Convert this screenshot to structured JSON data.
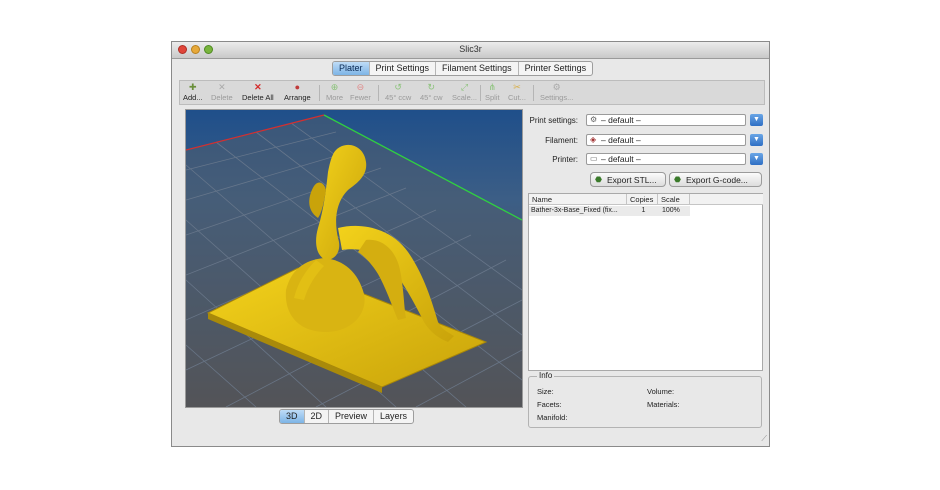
{
  "window": {
    "title": "Slic3r"
  },
  "tabs": [
    {
      "label": "Plater"
    },
    {
      "label": "Print Settings"
    },
    {
      "label": "Filament Settings"
    },
    {
      "label": "Printer Settings"
    }
  ],
  "toolbar": {
    "add": "Add...",
    "delete": "Delete",
    "delete_all": "Delete All",
    "arrange": "Arrange",
    "more": "More",
    "fewer": "Fewer",
    "rotate_ccw": "45° ccw",
    "rotate_cw": "45° cw",
    "scale": "Scale...",
    "split": "Split",
    "cut": "Cut...",
    "settings": "Settings..."
  },
  "presets": {
    "print_label": "Print settings:",
    "print_value": "– default –",
    "filament_label": "Filament:",
    "filament_value": "– default –",
    "printer_label": "Printer:",
    "printer_value": "– default –"
  },
  "export": {
    "stl": "Export STL...",
    "gcode": "Export G-code..."
  },
  "object_list": {
    "headers": {
      "name": "Name",
      "copies": "Copies",
      "scale": "Scale"
    },
    "rows": [
      {
        "name": "Bather-3x-Base_Fixed (fix...",
        "copies": "1",
        "scale": "100%"
      }
    ]
  },
  "info": {
    "title": "Info",
    "size": "Size:",
    "facets": "Facets:",
    "manifold": "Manifold:",
    "volume": "Volume:",
    "materials": "Materials:"
  },
  "view_tabs": [
    {
      "label": "3D"
    },
    {
      "label": "2D"
    },
    {
      "label": "Preview"
    },
    {
      "label": "Layers"
    }
  ]
}
